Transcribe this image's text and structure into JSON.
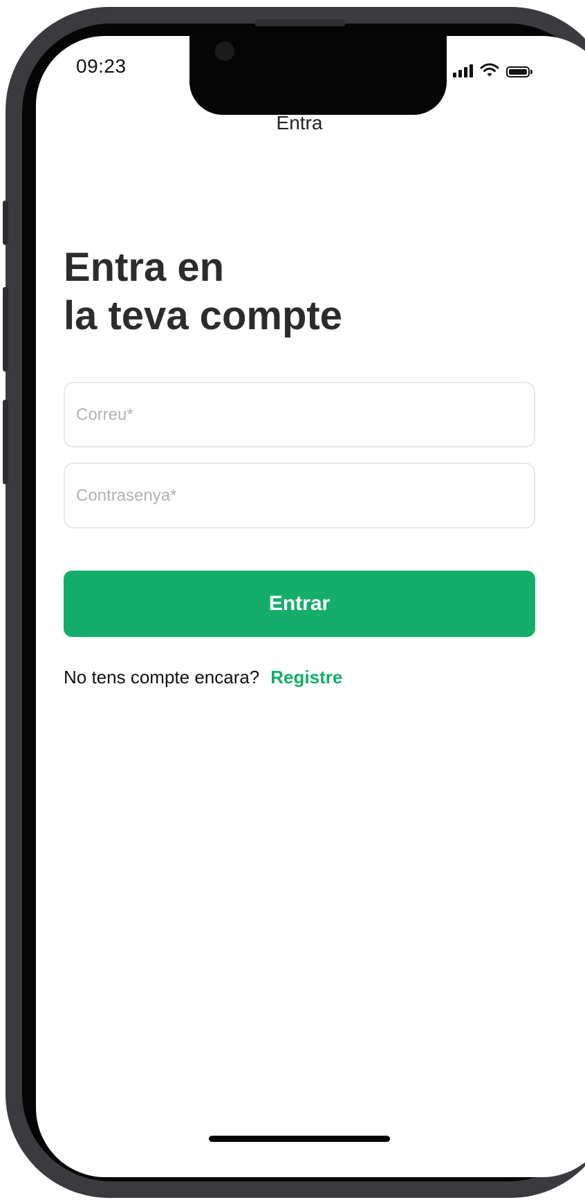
{
  "status_bar": {
    "time": "09:23",
    "icons": [
      "signal-icon",
      "wifi-icon",
      "battery-icon"
    ]
  },
  "nav": {
    "title": "Entra"
  },
  "heading": {
    "line1": "Entra en",
    "line2": "la teva compte"
  },
  "form": {
    "email_placeholder": "Correu*",
    "email_value": "",
    "password_placeholder": "Contrasenya*",
    "password_value": "",
    "submit_label": "Entrar"
  },
  "footer": {
    "prompt": "No tens compte encara?",
    "register_link": "Registre"
  },
  "colors": {
    "accent": "#14ae6a",
    "frame": "#3b3b3f",
    "text": "#2c2c2e"
  }
}
